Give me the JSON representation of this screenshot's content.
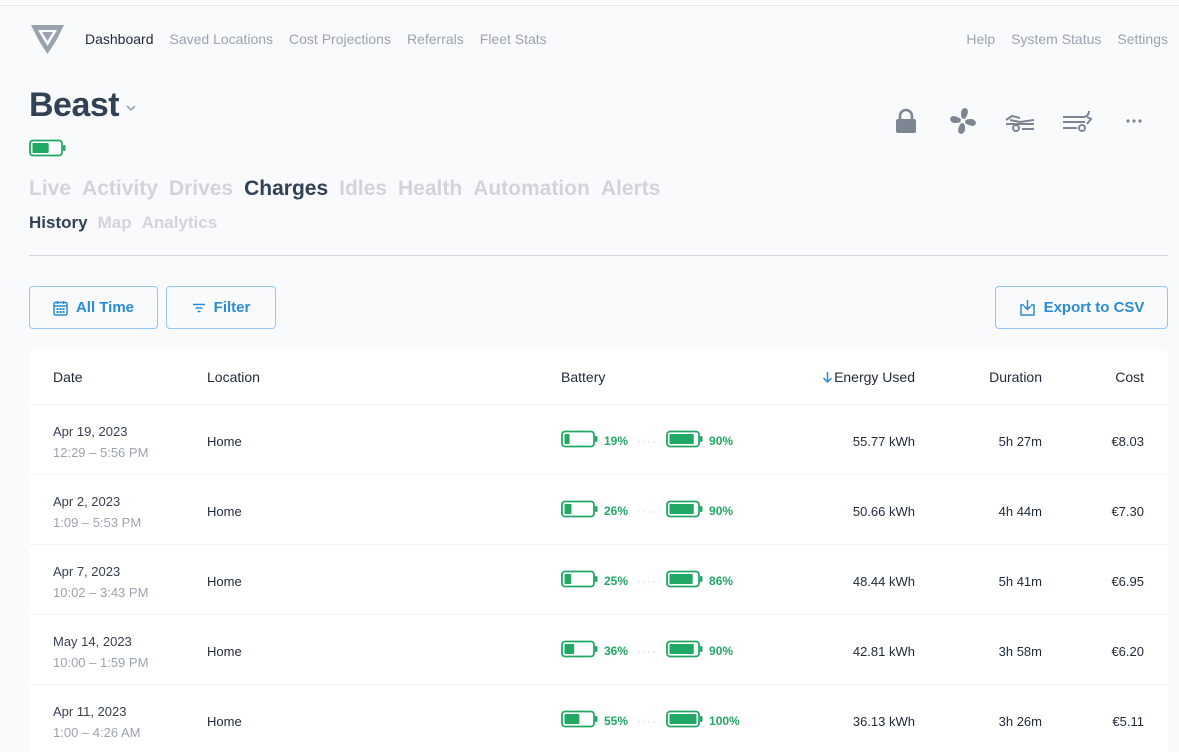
{
  "nav": {
    "links": [
      "Dashboard",
      "Saved Locations",
      "Cost Projections",
      "Referrals",
      "Fleet Stats"
    ],
    "right_links": [
      "Help",
      "System Status",
      "Settings"
    ]
  },
  "vehicle": {
    "name": "Beast",
    "battery_level": 0.6
  },
  "actions": [
    "lock-icon",
    "fan-icon",
    "frunk-icon",
    "trunk-icon",
    "more-icon"
  ],
  "tabs": [
    "Live",
    "Activity",
    "Drives",
    "Charges",
    "Idles",
    "Health",
    "Automation",
    "Alerts"
  ],
  "subtabs": [
    "History",
    "Map",
    "Analytics"
  ],
  "toolbar": {
    "all_time": "All Time",
    "filter": "Filter",
    "export": "Export to CSV"
  },
  "table": {
    "headers": {
      "date": "Date",
      "location": "Location",
      "battery": "Battery",
      "energy": "Energy Used",
      "duration": "Duration",
      "cost": "Cost"
    },
    "rows": [
      {
        "date": "Apr 19, 2023",
        "time": "12:29 – 5:56 PM",
        "location": "Home",
        "start_pct": "19%",
        "end_pct": "90%",
        "start_level": 0.19,
        "end_level": 0.9,
        "energy": "55.77 kWh",
        "duration": "5h 27m",
        "cost": "€8.03"
      },
      {
        "date": "Apr 2, 2023",
        "time": "1:09 – 5:53 PM",
        "location": "Home",
        "start_pct": "26%",
        "end_pct": "90%",
        "start_level": 0.26,
        "end_level": 0.9,
        "energy": "50.66 kWh",
        "duration": "4h 44m",
        "cost": "€7.30"
      },
      {
        "date": "Apr 7, 2023",
        "time": "10:02 – 3:43 PM",
        "location": "Home",
        "start_pct": "25%",
        "end_pct": "86%",
        "start_level": 0.25,
        "end_level": 0.86,
        "energy": "48.44 kWh",
        "duration": "5h 41m",
        "cost": "€6.95"
      },
      {
        "date": "May 14, 2023",
        "time": "10:00 – 1:59 PM",
        "location": "Home",
        "start_pct": "36%",
        "end_pct": "90%",
        "start_level": 0.36,
        "end_level": 0.9,
        "energy": "42.81 kWh",
        "duration": "3h 58m",
        "cost": "€6.20"
      },
      {
        "date": "Apr 11, 2023",
        "time": "1:00 – 4:26 AM",
        "location": "Home",
        "start_pct": "55%",
        "end_pct": "100%",
        "start_level": 0.55,
        "end_level": 1.0,
        "energy": "36.13 kWh",
        "duration": "3h 26m",
        "cost": "€5.11"
      }
    ]
  },
  "colors": {
    "accent": "#2a8bd6",
    "battery": "#22a865",
    "title": "#334155"
  }
}
